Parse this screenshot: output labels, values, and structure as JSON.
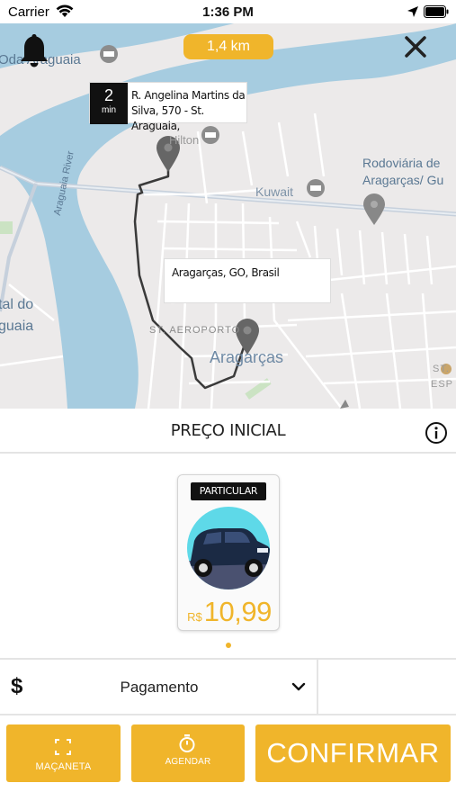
{
  "status_bar": {
    "carrier": "Carrier",
    "time": "1:36 PM"
  },
  "map": {
    "distance": "1,4 km",
    "eta": {
      "value": "2",
      "unit": "min",
      "address": "R. Angelina Martins da Silva, 570 - St. Araguaia,"
    },
    "destination": "Aragarças, GO, Brasil",
    "labels": {
      "river": "Araguaia River",
      "place_top": "Oda Araguaia",
      "hilton": "Hilton",
      "kuwait": "Kuwait",
      "rodoviaria_1": "Rodoviária de",
      "rodoviaria_2": "Aragarças/ Gu",
      "ital_1": "tal do",
      "ital_2": "guaia",
      "aeroporto": "ST. AEROPORTO",
      "city": "Aragarças",
      "st": "ST.",
      "esp": "ESP"
    },
    "route_color": "#3a3a3a",
    "water_color": "#a6cce0"
  },
  "price_header": {
    "title": "PREÇO INICIAL"
  },
  "vehicle": {
    "badge": "PARTICULAR",
    "currency": "R$",
    "price": "10,99"
  },
  "payment": {
    "icon": "$",
    "label": "Pagamento"
  },
  "buttons": {
    "macaneta": "MAÇANETA",
    "agendar": "AGENDAR",
    "confirmar": "CONFIRMAR"
  },
  "colors": {
    "accent": "#f0b52b",
    "dark": "#111111"
  }
}
